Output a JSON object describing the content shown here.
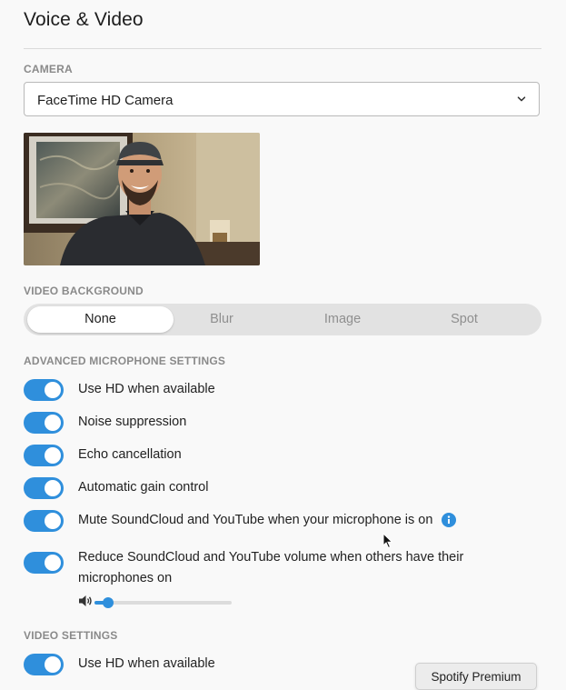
{
  "page": {
    "title": "Voice & Video"
  },
  "camera": {
    "section_label": "CAMERA",
    "selected": "FaceTime HD Camera"
  },
  "video_background": {
    "section_label": "VIDEO BACKGROUND",
    "options": [
      "None",
      "Blur",
      "Image",
      "Spot"
    ],
    "selected": "None"
  },
  "advanced_mic": {
    "section_label": "ADVANCED MICROPHONE SETTINGS",
    "toggles": [
      {
        "label": "Use HD when available",
        "on": true
      },
      {
        "label": "Noise suppression",
        "on": true
      },
      {
        "label": "Echo cancellation",
        "on": true
      },
      {
        "label": "Automatic gain control",
        "on": true
      },
      {
        "label": "Mute SoundCloud and YouTube when your microphone is on",
        "on": true
      },
      {
        "label": "Reduce SoundCloud and YouTube volume when others have their microphones on",
        "on": true
      }
    ],
    "volume_level": 0.1
  },
  "video_settings": {
    "section_label": "VIDEO SETTINGS",
    "toggles": [
      {
        "label": "Use HD when available",
        "on": true
      }
    ]
  },
  "floating_button": {
    "label": "Spotify Premium"
  },
  "colors": {
    "accent": "#2f8fdc",
    "segment_bg": "#e2e2e2",
    "label_gray": "#8a8a8a"
  },
  "icons": [
    "chevron-down-icon",
    "info-icon",
    "volume-icon",
    "mouse-cursor-icon"
  ]
}
